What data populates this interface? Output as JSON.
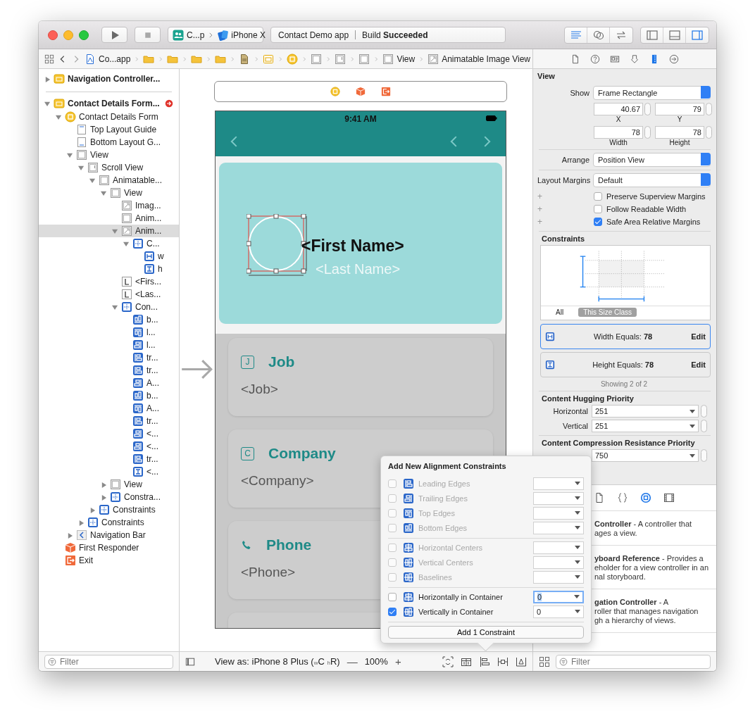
{
  "toolbar": {
    "scheme": "C...p",
    "device": "iPhone X",
    "project": "Contact Demo app",
    "status": "Build **Succeeded**",
    "editor_buttons": [
      {
        "kind": "standard",
        "selected": true
      },
      {
        "kind": "assistant",
        "selected": false
      },
      {
        "kind": "version",
        "selected": false
      }
    ],
    "view_buttons": [
      {
        "kind": "navigator",
        "selected": false
      },
      {
        "kind": "debug",
        "selected": false
      },
      {
        "kind": "utilities",
        "selected": true
      }
    ]
  },
  "jump_bar": {
    "crumbs": [
      {
        "kind": "projectfile",
        "label": "Co...app"
      },
      {
        "kind": "folder"
      },
      {
        "kind": "folder"
      },
      {
        "kind": "folder"
      },
      {
        "kind": "folder"
      },
      {
        "kind": "storyboard"
      },
      {
        "kind": "scene"
      },
      {
        "kind": "vccircle"
      },
      {
        "kind": "view"
      },
      {
        "kind": "scroll"
      },
      {
        "kind": "view"
      },
      {
        "kind": "view",
        "label": "View"
      },
      {
        "kind": "image",
        "label": "Animatable Image View"
      }
    ]
  },
  "outline": {
    "items": [
      {
        "name": "Navigation Controller...",
        "kind": "vc",
        "expanded": false,
        "selected": false,
        "error": false
      },
      {
        "name": "Contact Details Form...",
        "kind": "vc",
        "expanded": true,
        "selected": false,
        "error": true,
        "children": [
          {
            "name": "Contact Details Form",
            "kind": "vccircle",
            "expanded": true,
            "selected": false,
            "children": [
              {
                "name": "Top Layout Guide",
                "kind": "topguide",
                "selected": false
              },
              {
                "name": "Bottom Layout G...",
                "kind": "bottomguide",
                "selected": false
              },
              {
                "name": "View",
                "kind": "view",
                "expanded": true,
                "selected": false,
                "children": [
                  {
                    "name": "Scroll View",
                    "kind": "scroll",
                    "expanded": true,
                    "selected": false,
                    "children": [
                      {
                        "name": "Animatable...",
                        "kind": "view",
                        "expanded": true,
                        "selected": false,
                        "children": [
                          {
                            "name": "View",
                            "kind": "view",
                            "expanded": true,
                            "selected": false,
                            "children": [
                              {
                                "name": "Imag...",
                                "kind": "image",
                                "selected": false
                              },
                              {
                                "name": "Anim...",
                                "kind": "view",
                                "selected": false
                              },
                              {
                                "name": "Anim...",
                                "kind": "image",
                                "expanded": true,
                                "selected": true,
                                "children": [
                                  {
                                    "name": "C...",
                                    "kind": "constraints",
                                    "expanded": true,
                                    "selected": false,
                                    "children": [
                                      {
                                        "name": "w",
                                        "kind": "hconstraint",
                                        "selected": false
                                      },
                                      {
                                        "name": "h",
                                        "kind": "vconstraint",
                                        "selected": false
                                      }
                                    ]
                                  }
                                ]
                              },
                              {
                                "name": "<Firs...",
                                "kind": "label",
                                "selected": false
                              },
                              {
                                "name": "<Las...",
                                "kind": "label",
                                "selected": false
                              },
                              {
                                "name": "Con...",
                                "kind": "constraints",
                                "expanded": true,
                                "selected": false,
                                "children": [
                                  {
                                    "name": "b...",
                                    "kind": "bottom",
                                    "selected": false
                                  },
                                  {
                                    "name": "l...",
                                    "kind": "top",
                                    "selected": false
                                  },
                                  {
                                    "name": "l...",
                                    "kind": "trailing",
                                    "selected": false
                                  },
                                  {
                                    "name": "tr...",
                                    "kind": "leading",
                                    "selected": false
                                  },
                                  {
                                    "name": "tr...",
                                    "kind": "leading",
                                    "selected": false
                                  },
                                  {
                                    "name": "A...",
                                    "kind": "trailing",
                                    "selected": false
                                  },
                                  {
                                    "name": "b...",
                                    "kind": "bottom",
                                    "selected": false
                                  },
                                  {
                                    "name": "A...",
                                    "kind": "top",
                                    "selected": false
                                  },
                                  {
                                    "name": "tr...",
                                    "kind": "leading",
                                    "selected": false
                                  },
                                  {
                                    "name": "<...",
                                    "kind": "trailing",
                                    "selected": false
                                  },
                                  {
                                    "name": "<...",
                                    "kind": "trailing",
                                    "selected": false
                                  },
                                  {
                                    "name": "tr...",
                                    "kind": "leading",
                                    "selected": false
                                  },
                                  {
                                    "name": "<...",
                                    "kind": "vconstraint",
                                    "selected": false
                                  }
                                ]
                              }
                            ]
                          },
                          {
                            "name": "View",
                            "kind": "view",
                            "expanded": false,
                            "selected": false
                          },
                          {
                            "name": "Constra...",
                            "kind": "constraints",
                            "expanded": false,
                            "selected": false
                          }
                        ]
                      },
                      {
                        "name": "Constraints",
                        "kind": "constraints",
                        "expanded": false,
                        "selected": false
                      }
                    ]
                  },
                  {
                    "name": "Constraints",
                    "kind": "constraints",
                    "expanded": false,
                    "selected": false
                  }
                ]
              },
              {
                "name": "Navigation Bar",
                "kind": "navbar",
                "expanded": false,
                "selected": false
              }
            ]
          },
          {
            "name": "First Responder",
            "kind": "responder",
            "selected": false
          },
          {
            "name": "Exit",
            "kind": "exit",
            "selected": false
          }
        ]
      }
    ],
    "filter": {
      "placeholder": "Filter"
    }
  },
  "canvas": {
    "scene_dock": [
      {
        "kind": "vccircle"
      },
      {
        "kind": "responder"
      },
      {
        "kind": "exit"
      }
    ],
    "phone": {
      "time": "9:41 AM",
      "first_name": "<First Name>",
      "last_name": "<Last Name>",
      "cards": [
        {
          "kind": "letter",
          "glyph": "J",
          "title": "Job",
          "value": "<Job>"
        },
        {
          "kind": "letter",
          "glyph": "C",
          "title": "Company",
          "value": "<Company>"
        },
        {
          "kind": "phone",
          "title": "Phone",
          "value": "<Phone>"
        },
        {
          "kind": "note"
        }
      ]
    }
  },
  "canvas_bar": {
    "view_as": "View as: iPhone 8 Plus ($_{w}$C $_{h}$R)",
    "zoom_out": "—",
    "zoom": "100%",
    "zoom_in": "+",
    "tools": [
      {
        "kind": "update"
      },
      {
        "kind": "embed"
      },
      {
        "kind": "align"
      },
      {
        "kind": "pin"
      },
      {
        "kind": "resolve"
      }
    ]
  },
  "inspector": {
    "tabs": [
      {
        "kind": "file",
        "selected": false
      },
      {
        "kind": "help",
        "selected": false
      },
      {
        "kind": "identity",
        "selected": false
      },
      {
        "kind": "attributes",
        "selected": false
      },
      {
        "kind": "size",
        "selected": true
      },
      {
        "kind": "connections",
        "selected": false
      }
    ],
    "section": "View",
    "show": {
      "label": "Show",
      "value": "Frame Rectangle"
    },
    "frame": [
      {
        "value": "40.67",
        "caption": "X"
      },
      {
        "value": "79",
        "caption": "Y"
      },
      {
        "value": "78",
        "caption": "Width"
      },
      {
        "value": "78",
        "caption": "Height"
      }
    ],
    "arrange": {
      "label": "Arrange",
      "value": "Position View"
    },
    "margins": {
      "label": "Layout Margins",
      "value": "Default"
    },
    "options": [
      {
        "plus": "+",
        "label": "Preserve Superview Margins",
        "checked": false
      },
      {
        "plus": "+",
        "label": "Follow Readable Width",
        "checked": false
      },
      {
        "plus": "+",
        "label": "Safe Area Relative Margins",
        "checked": true
      }
    ],
    "constraints": {
      "title": "Constraints",
      "filters": [
        {
          "label": "All",
          "selected": false
        },
        {
          "label": "This Size Class",
          "selected": true
        }
      ],
      "items": [
        {
          "kind": "hconstraint",
          "label": "Width Equals:",
          "value": "78",
          "action": "Edit",
          "selected": true
        },
        {
          "kind": "vconstraint",
          "label": "Height Equals:",
          "value": "78",
          "action": "Edit",
          "selected": false
        }
      ],
      "count": "Showing 2 of 2"
    },
    "hugging": {
      "title": "Content Hugging Priority",
      "rows": [
        {
          "label": "Horizontal",
          "value": "251"
        },
        {
          "label": "Vertical",
          "value": "251"
        }
      ]
    },
    "compression": {
      "title": "Content Compression Resistance Priority",
      "rows": [
        {
          "value": "750"
        }
      ]
    }
  },
  "library": {
    "tabs": [
      {
        "kind": "file",
        "selected": false
      },
      {
        "kind": "code",
        "selected": false
      },
      {
        "kind": "object",
        "selected": true
      },
      {
        "kind": "media",
        "selected": false
      }
    ],
    "items": [
      {
        "lines": [
          "**Controller** - A controller that",
          "ages a view."
        ]
      },
      {
        "lines": [
          "**yboard Reference** - Provides a",
          "eholder for a view controller in an",
          "nal storyboard."
        ]
      },
      {
        "lines": [
          "**gation Controller** - A",
          "roller that manages navigation",
          "gh a hierarchy of views."
        ]
      }
    ],
    "filter": {
      "placeholder": "Filter"
    }
  },
  "popover": {
    "title": "Add New Alignment Constraints",
    "groups": [
      [
        {
          "kind": "leading",
          "label": "Leading Edges",
          "checked": false,
          "disabled": true,
          "focused": false
        },
        {
          "kind": "trailing",
          "label": "Trailing Edges",
          "checked": false,
          "disabled": true,
          "focused": false
        },
        {
          "kind": "top",
          "label": "Top Edges",
          "checked": false,
          "disabled": true,
          "focused": false
        },
        {
          "kind": "bottom",
          "label": "Bottom Edges",
          "checked": false,
          "disabled": true,
          "focused": false
        }
      ],
      [
        {
          "kind": "hcenter",
          "label": "Horizontal Centers",
          "checked": false,
          "disabled": true,
          "focused": false
        },
        {
          "kind": "vcenter",
          "label": "Vertical Centers",
          "checked": false,
          "disabled": true,
          "focused": false
        },
        {
          "kind": "vcenter",
          "label": "Baselines",
          "checked": false,
          "disabled": true,
          "focused": false
        }
      ],
      [
        {
          "kind": "hcenter",
          "label": "Horizontally in Container",
          "checked": false,
          "disabled": false,
          "value": "0",
          "focused": true
        },
        {
          "kind": "vcenter",
          "label": "Vertically in Container",
          "checked": true,
          "disabled": false,
          "value": "0",
          "focused": false
        }
      ]
    ],
    "button": "Add 1 Constraint"
  }
}
